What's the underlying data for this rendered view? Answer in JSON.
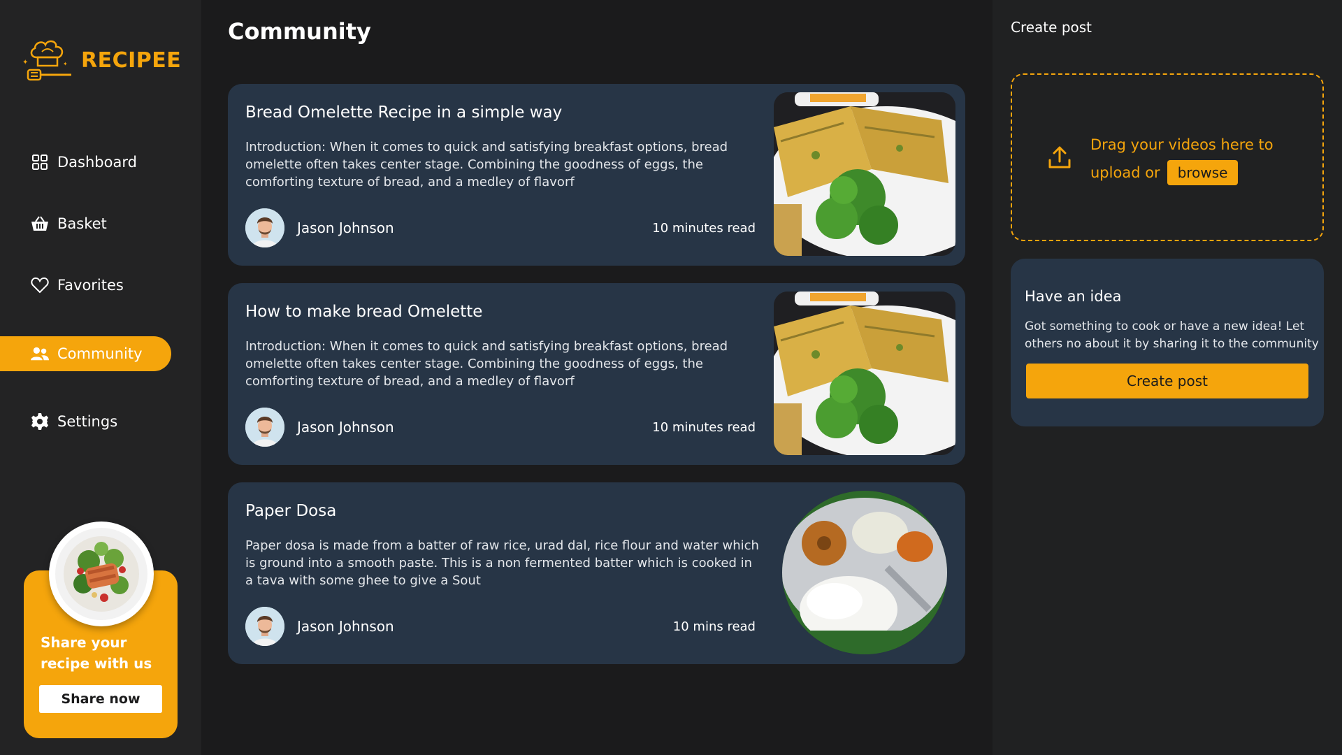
{
  "brand": {
    "name": "RECIPEE",
    "accent": "#f5a50c"
  },
  "sidebar": {
    "items": [
      {
        "label": "Dashboard",
        "icon": "grid-icon",
        "active": false
      },
      {
        "label": "Basket",
        "icon": "basket-icon",
        "active": false
      },
      {
        "label": "Favorites",
        "icon": "heart-icon",
        "active": false
      },
      {
        "label": "Community",
        "icon": "users-icon",
        "active": true
      },
      {
        "label": "Settings",
        "icon": "gear-icon",
        "active": false
      }
    ],
    "promo": {
      "text": "Share your recipe with us",
      "button": "Share now",
      "image": "salmon-salad-plate"
    }
  },
  "main": {
    "title": "Community",
    "posts": [
      {
        "title": "Bread Omelette Recipe in a simple way",
        "body": "Introduction: When it comes to quick and satisfying breakfast options, bread omelette often takes center stage. Combining the goodness of eggs, the comforting texture of bread, and a medley of flavorf",
        "author": "Jason Johnson",
        "read_time": "10 minutes read",
        "image": "bread-omelette"
      },
      {
        "title": "How to make bread Omelette",
        "body": "Introduction: When it comes to quick and satisfying breakfast options, bread omelette often takes center stage. Combining the goodness of eggs, the comforting texture of bread, and a medley of flavorf",
        "author": "Jason Johnson",
        "read_time": "10 minutes read",
        "image": "bread-omelette"
      },
      {
        "title": "Paper Dosa",
        "body": "Paper dosa is made from a batter of raw rice, urad dal, rice flour and water which is ground into a smooth paste. This is a non fermented batter which is cooked in a tava with some ghee to give a Sout",
        "author": "Jason Johnson",
        "read_time": "10 mins read",
        "image": "idli-vada-plate"
      }
    ]
  },
  "right": {
    "title": "Create post",
    "dropzone": {
      "text": "Drag your videos here to upload or",
      "browse": "browse"
    },
    "idea": {
      "title": "Have an idea",
      "body": "Got something to cook or have a new idea! Let others no about it by sharing it to the community",
      "button": "Create post"
    }
  }
}
